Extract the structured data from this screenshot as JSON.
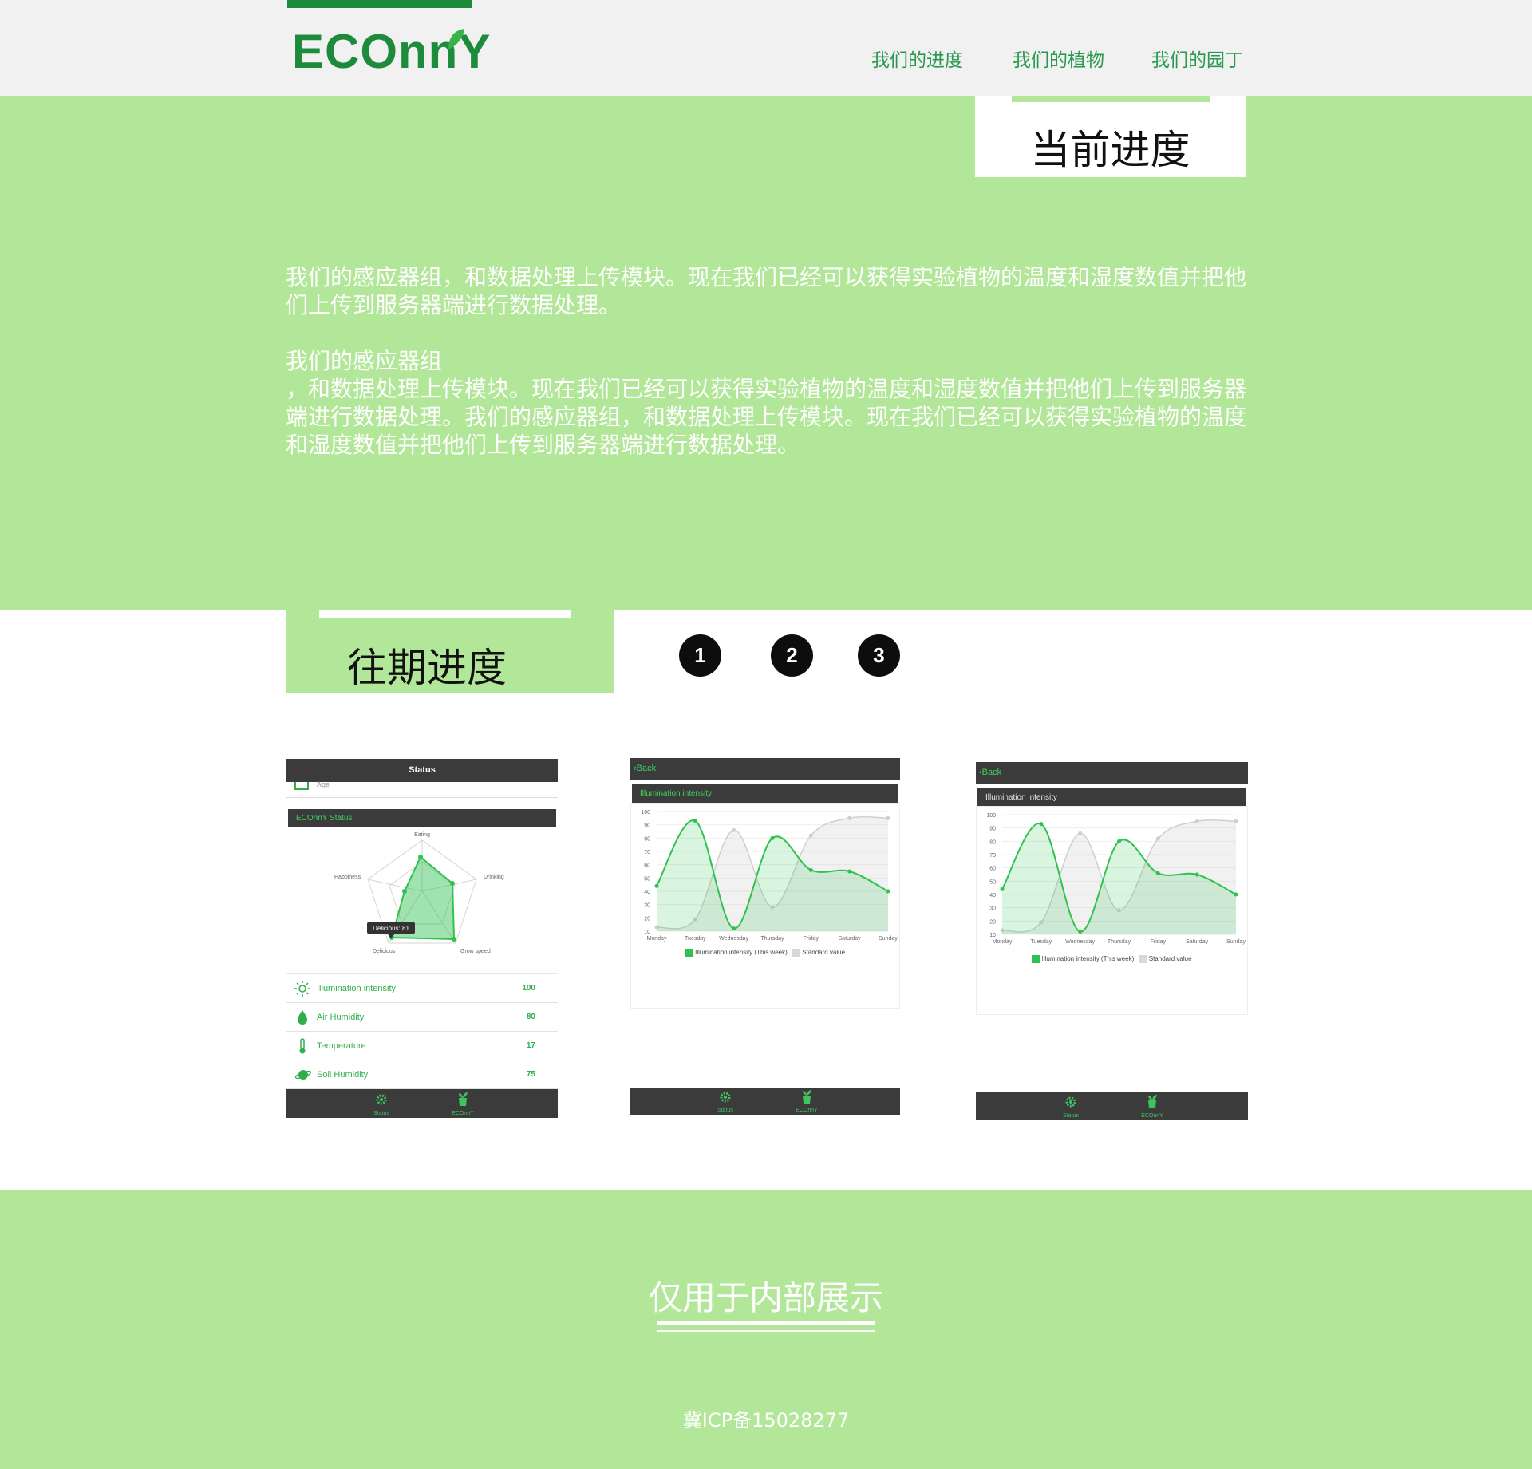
{
  "header": {
    "logo": "ECOnnY",
    "nav": [
      "我们的进度",
      "我们的植物",
      "我们的园丁"
    ]
  },
  "hero": {
    "current_title": "当前进度",
    "para1": "我们的感应器组，和数据处理上传模块。现在我们已经可以获得实验植物的温度和湿度数值并把他们上传到服务器端进行数据处理。",
    "para2_head": "我们的感应器组",
    "para2_body": "，和数据处理上传模块。现在我们已经可以获得实验植物的温度和湿度数值并把他们上传到服务器端进行数据处理。我们的感应器组，和数据处理上传模块。现在我们已经可以获得实验植物的温度和湿度数值并把他们上传到服务器端进行数据处理。"
  },
  "past": {
    "title": "往期进度",
    "pages": [
      "1",
      "2",
      "3"
    ]
  },
  "shot1": {
    "header": "Status",
    "age_label": "Age",
    "section": "ECOnnY Status",
    "radar_axes": [
      "Eating",
      "Drinking",
      "Grow speed",
      "Delicious",
      "Happiness"
    ],
    "tooltip": "Delicious: 81",
    "rows": [
      {
        "label": "Illumination intensity",
        "value": "100",
        "icon": "sun-icon"
      },
      {
        "label": "Air Humidity",
        "value": "80",
        "icon": "drop-icon"
      },
      {
        "label": "Temperature",
        "value": "17",
        "icon": "thermometer-icon"
      },
      {
        "label": "Soil Humidity",
        "value": "75",
        "icon": "planet-icon"
      }
    ],
    "tabs": [
      "Status",
      "ECOnnY"
    ]
  },
  "chart_shots": {
    "back": "Back",
    "title": "Illumination intensity",
    "tabs": [
      "Status",
      "ECOnnY"
    ]
  },
  "chart_data": [
    {
      "type": "line",
      "title": "Illumination intensity",
      "categories": [
        "Monday",
        "Tuesday",
        "Wednesday",
        "Thursday",
        "Friday",
        "Saturday",
        "Sunday"
      ],
      "y_ticks": [
        10,
        20,
        30,
        40,
        50,
        60,
        70,
        80,
        90,
        100
      ],
      "ylim": [
        10,
        100
      ],
      "series": [
        {
          "name": "Illumination intensity (This week)",
          "values": [
            44,
            93,
            12,
            80,
            56,
            55,
            40
          ],
          "color": "#2fc24f"
        },
        {
          "name": "Standard value",
          "values": [
            13,
            19,
            86,
            28,
            82,
            95,
            95
          ],
          "color": "#cfcfcf"
        }
      ],
      "legend": "bottom"
    },
    {
      "type": "line",
      "title": "Illumination intensity",
      "categories": [
        "Monday",
        "Tuesday",
        "Wednesday",
        "Thursday",
        "Friday",
        "Saturday",
        "Sunday"
      ],
      "y_ticks": [
        10,
        20,
        30,
        40,
        50,
        60,
        70,
        80,
        90,
        100
      ],
      "ylim": [
        10,
        100
      ],
      "series": [
        {
          "name": "Illumination intensity (This week)",
          "values": [
            44,
            93,
            12,
            80,
            56,
            55,
            40
          ],
          "color": "#2fc24f"
        },
        {
          "name": "Standard value",
          "values": [
            13,
            19,
            86,
            28,
            82,
            95,
            95
          ],
          "color": "#cfcfcf"
        }
      ],
      "legend": "bottom"
    }
  ],
  "footer": {
    "slogan": "仅用于内部展示",
    "icp": "冀ICP备15028277"
  },
  "colors": {
    "brand_green": "#1e8a3c",
    "light_green": "#b2e698",
    "chart_green": "#2fc24f"
  }
}
